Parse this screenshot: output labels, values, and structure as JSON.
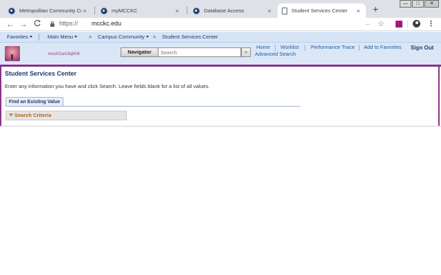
{
  "browser": {
    "tabs": [
      {
        "label": "Metropolitan Community College",
        "close": "×"
      },
      {
        "label": "myMCCKC",
        "close": "×"
      },
      {
        "label": "Database Access",
        "close": "×"
      },
      {
        "label": "Student Services Center",
        "close": "×"
      }
    ],
    "new_tab": "+",
    "window_controls": {
      "minimize": "—",
      "maximize": "□",
      "close": "✕"
    },
    "url": {
      "protocol": "https://",
      "host": "mcckc.edu"
    },
    "nav": {
      "back": "←",
      "forward": "→",
      "reload": "C"
    },
    "more": "...",
    "bookmark_star": "☆",
    "menu": "⋮"
  },
  "ps_nav": {
    "favorites": "Favorites",
    "main_menu": "Main Menu",
    "sep1": ">",
    "campus_community": "Campus Community",
    "sep2": ">",
    "current": "Student Services Center"
  },
  "ps_header": {
    "server": "mcc01w10q004",
    "navigator": "Navigator",
    "search_placeholder": "Search",
    "go": "»",
    "links": {
      "home": "Home",
      "worklist": "Worklist",
      "performance_trace": "Performance Trace",
      "add_to_favorites": "Add to Favorites",
      "sign_out": "Sign Out",
      "advanced_search": "Advanced Search"
    }
  },
  "content": {
    "title": "Student Services Center",
    "instructions": "Enter any information you have and click Search. Leave fields blank for a list of all values.",
    "tab_find": "Find an Existing Value",
    "search_criteria": "Search Criteria"
  },
  "colors": {
    "accent_purple": "#8b2f8b",
    "nav_blue": "#d6e4f5",
    "link_blue": "#1d5aa8",
    "criteria_orange": "#b0621a"
  }
}
